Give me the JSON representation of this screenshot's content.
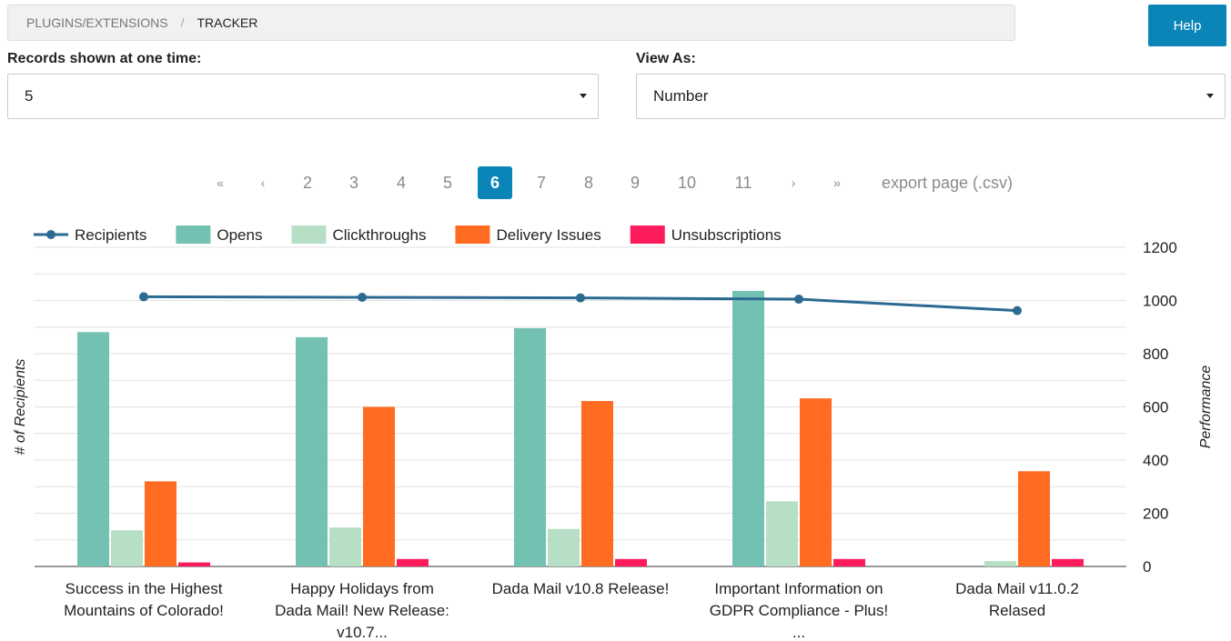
{
  "breadcrumb": {
    "parent": "PLUGINS/EXTENSIONS",
    "separator": "/",
    "current": "TRACKER"
  },
  "help_label": "Help",
  "records": {
    "label": "Records shown at one time:",
    "value": "5"
  },
  "view_as": {
    "label": "View As:",
    "value": "Number"
  },
  "pagination": {
    "first": "«",
    "prev": "‹",
    "next": "›",
    "last": "»",
    "pages": [
      "2",
      "3",
      "4",
      "5",
      "6",
      "7",
      "8",
      "9",
      "10",
      "11"
    ],
    "active": "6",
    "export": "export page (.csv)"
  },
  "chart_data": {
    "type": "bar",
    "categories": [
      [
        "Success in the Highest",
        "Mountains of Colorado!"
      ],
      [
        "Happy Holidays from",
        "Dada Mail! New Release:",
        "v10.7..."
      ],
      [
        "Dada Mail v10.8 Release!"
      ],
      [
        "Important Information on",
        "GDPR Compliance - Plus!",
        "..."
      ],
      [
        "Dada Mail v11.0.2",
        "Relased"
      ]
    ],
    "series": [
      {
        "name": "Recipients",
        "kind": "line",
        "color": "#2b6a91",
        "values": [
          1014,
          1012,
          1010,
          1005,
          962
        ]
      },
      {
        "name": "Opens",
        "kind": "bar",
        "color": "#72c1b3",
        "values": [
          881,
          862,
          896,
          1036,
          0
        ]
      },
      {
        "name": "Clickthroughs",
        "kind": "bar",
        "color": "#b6dfc6",
        "values": [
          136,
          146,
          141,
          245,
          20
        ]
      },
      {
        "name": "Delivery Issues",
        "kind": "bar",
        "color": "#ff6c21",
        "values": [
          320,
          600,
          622,
          632,
          358
        ]
      },
      {
        "name": "Unsubscriptions",
        "kind": "bar",
        "color": "#ff1c5c",
        "values": [
          15,
          28,
          28,
          28,
          28
        ]
      }
    ],
    "ylabel": "# of Recipients",
    "y2label": "Performance",
    "ylim": [
      0,
      1200
    ],
    "yticks": [
      "0",
      "200",
      "400",
      "600",
      "800",
      "1000",
      "1200"
    ],
    "ytick_values": [
      0,
      200,
      400,
      600,
      800,
      1000,
      1200
    ],
    "grid": true,
    "legend": "top-left"
  }
}
